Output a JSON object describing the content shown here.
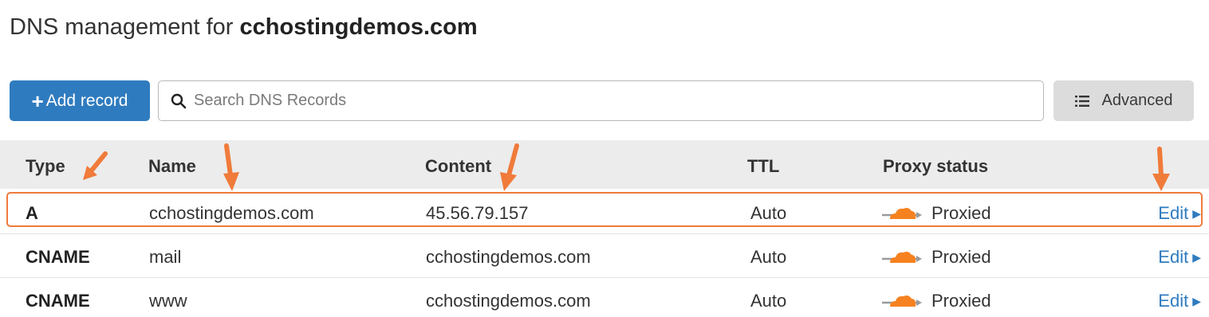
{
  "page": {
    "title_prefix": "DNS management for ",
    "domain": "cchostingdemos.com"
  },
  "toolbar": {
    "add_label": "Add record",
    "add_icon": "plus-icon",
    "search_placeholder": "Search DNS Records",
    "search_icon": "magnifier-icon",
    "advanced_label": "Advanced",
    "advanced_icon": "list-icon"
  },
  "table": {
    "columns": [
      "Type",
      "Name",
      "Content",
      "TTL",
      "Proxy status"
    ],
    "rows": [
      {
        "type": "A",
        "name": "cchostingdemos.com",
        "content": "45.56.79.157",
        "ttl": "Auto",
        "proxy": "Proxied",
        "edit": "Edit"
      },
      {
        "type": "CNAME",
        "name": "mail",
        "content": "cchostingdemos.com",
        "ttl": "Auto",
        "proxy": "Proxied",
        "edit": "Edit"
      },
      {
        "type": "CNAME",
        "name": "www",
        "content": "cchostingdemos.com",
        "ttl": "Auto",
        "proxy": "Proxied",
        "edit": "Edit"
      }
    ]
  },
  "colors": {
    "accent": "#2f7bbf",
    "annotation": "#f07b3a",
    "cloud": "#f6821f"
  }
}
